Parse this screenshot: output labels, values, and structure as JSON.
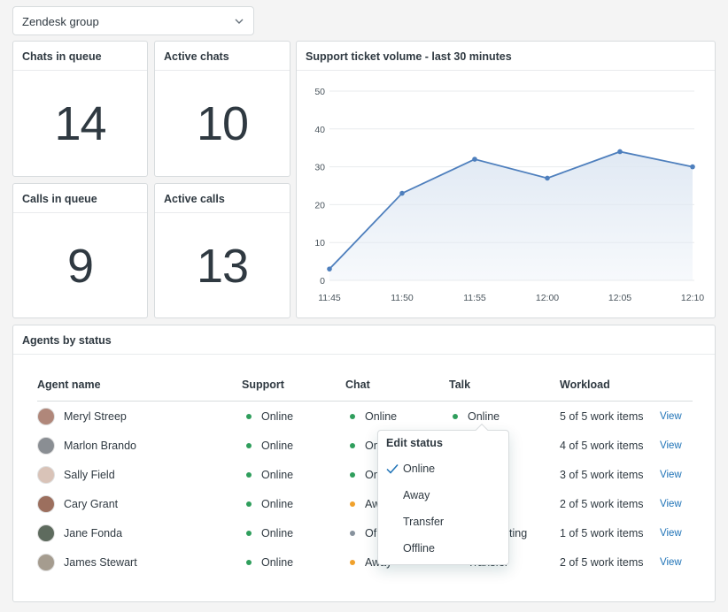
{
  "group_select": {
    "value": "Zendesk group"
  },
  "stats": [
    {
      "title": "Chats in queue",
      "value": "14"
    },
    {
      "title": "Active chats",
      "value": "10"
    },
    {
      "title": "Calls in queue",
      "value": "9"
    },
    {
      "title": "Active calls",
      "value": "13"
    }
  ],
  "chart": {
    "title": "Support ticket volume - last 30 minutes"
  },
  "chart_data": {
    "type": "area",
    "title": "Support ticket volume - last 30 minutes",
    "xlabel": "",
    "ylabel": "",
    "categories": [
      "11:45",
      "11:50",
      "11:55",
      "12:00",
      "12:05",
      "12:10"
    ],
    "values": [
      3,
      23,
      32,
      27,
      34,
      30
    ],
    "yticks": [
      "0",
      "10",
      "20",
      "30",
      "40",
      "50"
    ],
    "ylim": [
      0,
      50
    ],
    "grid": true,
    "colors": {
      "line": "#4e7fbd",
      "fill": "#dfe8f3"
    }
  },
  "agents": {
    "title": "Agents by status",
    "headers": {
      "name": "Agent name",
      "support": "Support",
      "chat": "Chat",
      "talk": "Talk",
      "workload": "Workload"
    },
    "rows": [
      {
        "name": "Meryl Streep",
        "support": "Online",
        "chat": "Online",
        "talk": "Online",
        "workload": "5 of 5 work items",
        "action": "View"
      },
      {
        "name": "Marlon Brando",
        "support": "Online",
        "chat": "On",
        "talk": "",
        "workload": "4 of 5 work items",
        "action": "View"
      },
      {
        "name": "Sally Field",
        "support": "Online",
        "chat": "On",
        "talk": "",
        "workload": "3 of 5 work items",
        "action": "View"
      },
      {
        "name": "Cary Grant",
        "support": "Online",
        "chat": "Aw",
        "talk": "",
        "workload": "2 of 5 work items",
        "action": "View"
      },
      {
        "name": "Jane Fonda",
        "support": "Online",
        "chat": "Of",
        "talk": "ting",
        "workload": "1 of 5 work items",
        "action": "View"
      },
      {
        "name": "James Stewart",
        "support": "Online",
        "chat": "Away",
        "talk": "Transfer",
        "workload": "2 of 5 work items",
        "action": "View"
      }
    ]
  },
  "status_colors": {
    "online": "#2f9e5c",
    "away": "#f0a12c",
    "offline": "#87929d"
  },
  "edit_status": {
    "title": "Edit status",
    "options": [
      "Online",
      "Away",
      "Transfer",
      "Offline"
    ],
    "selected": "Online"
  }
}
